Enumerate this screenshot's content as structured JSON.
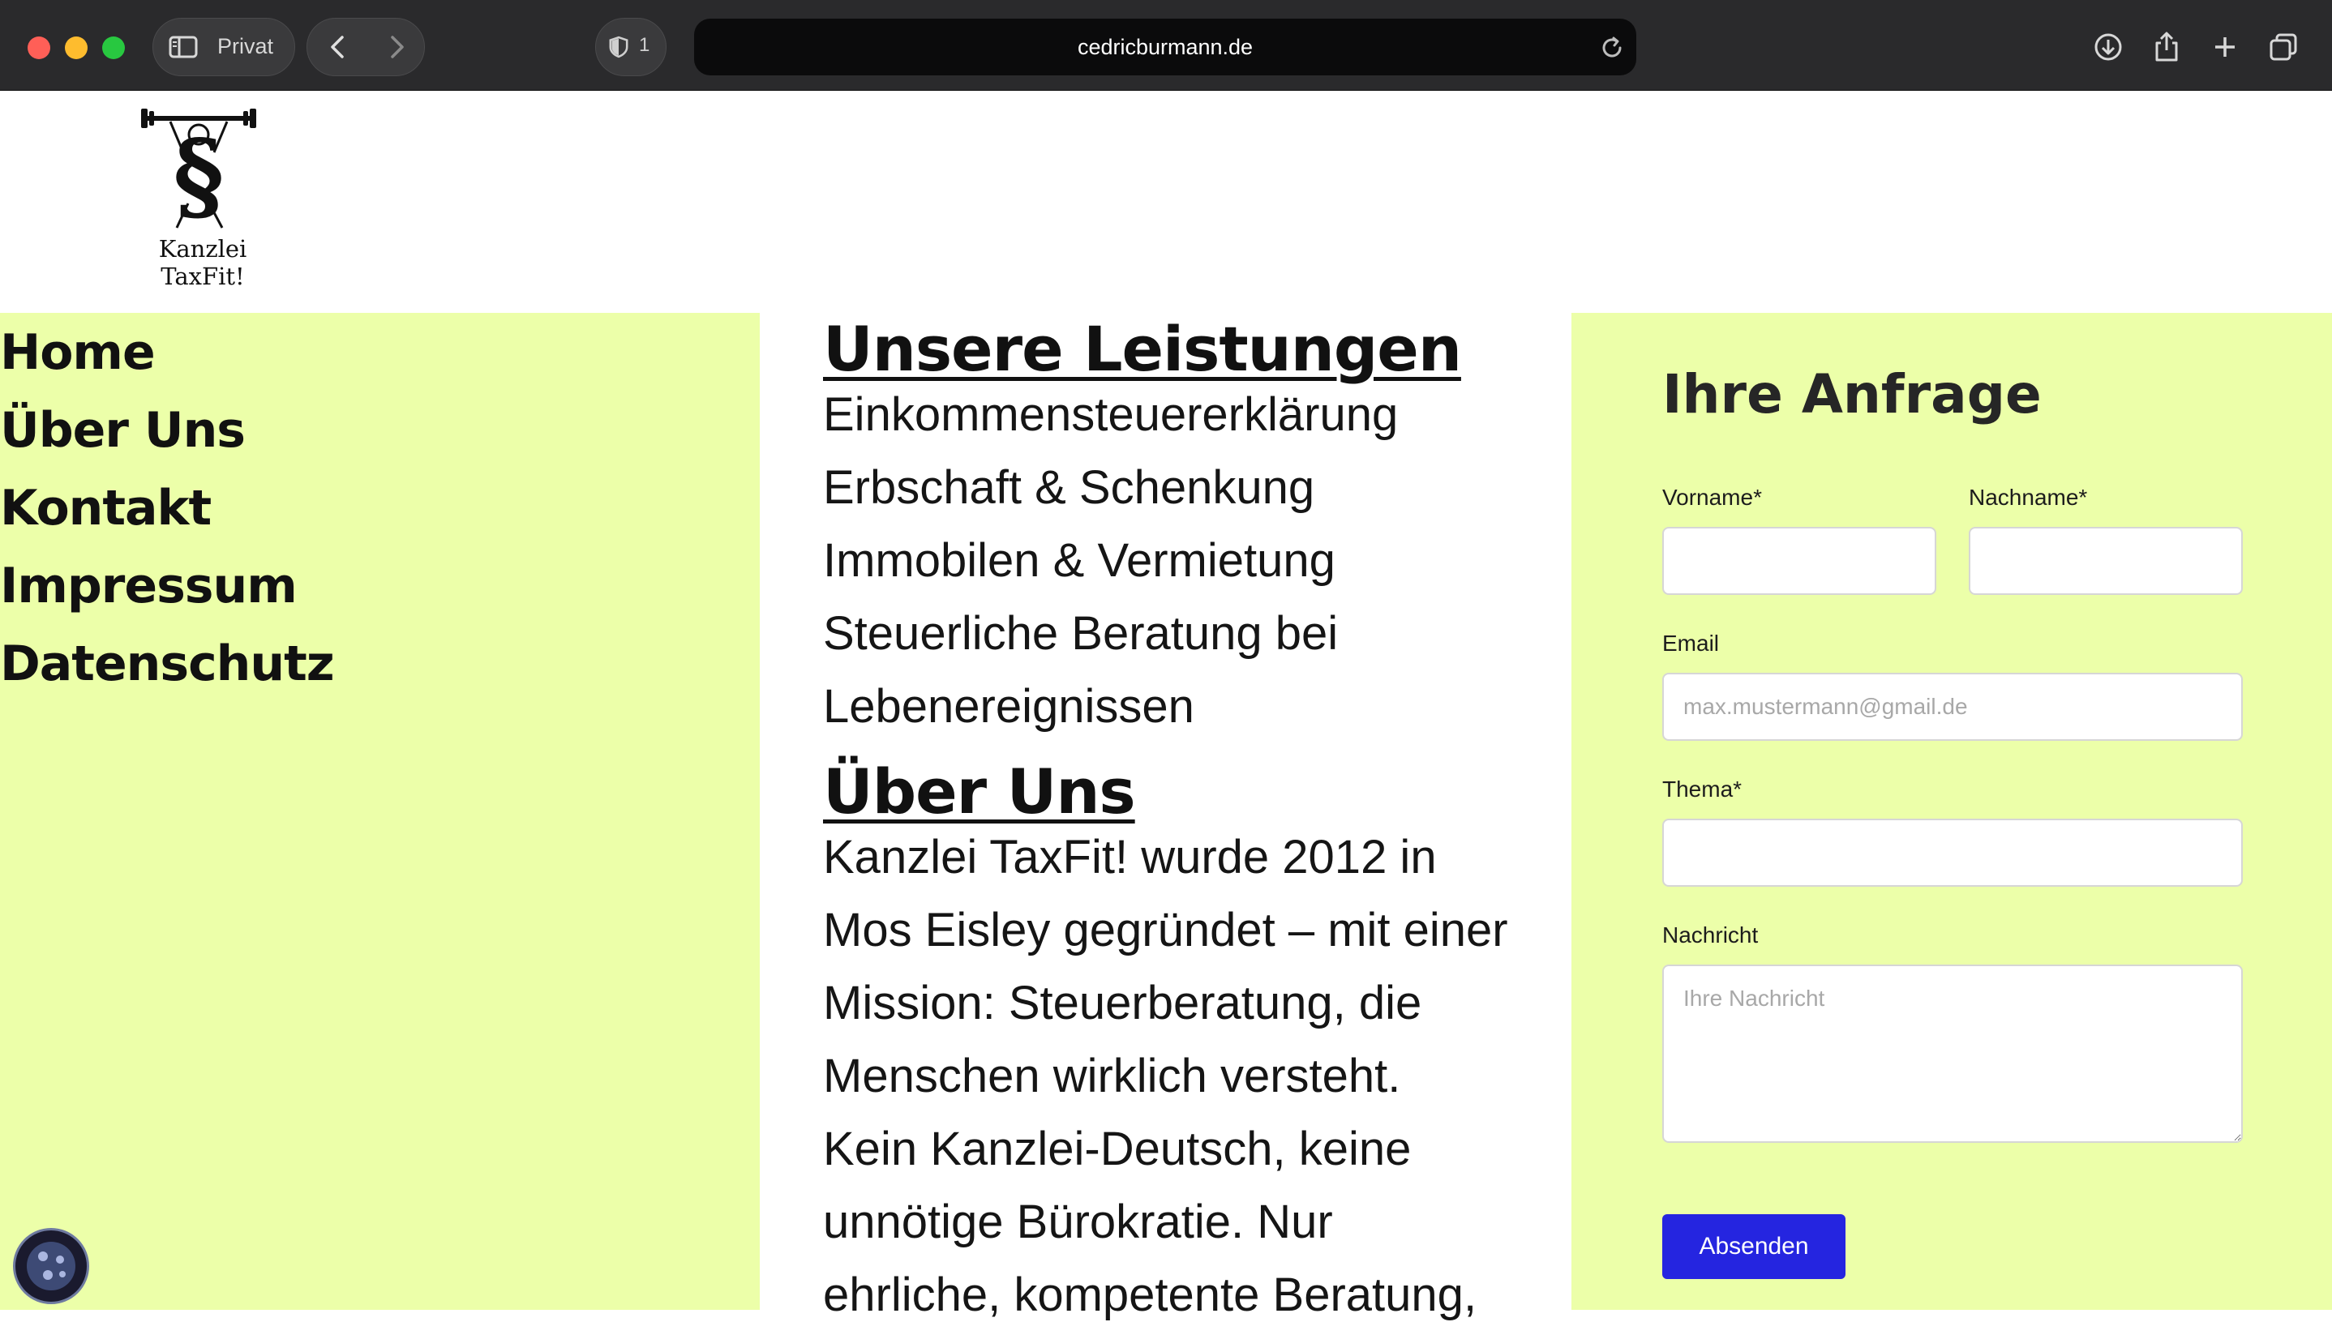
{
  "browser": {
    "private_label": "Privat",
    "tracker_count": "1",
    "url": "cedricburmann.de"
  },
  "logo": {
    "text": "Kanzlei TaxFit!"
  },
  "nav": {
    "items": [
      "Home",
      "Über Uns",
      "Kontakt",
      "Impressum",
      "Datenschutz"
    ]
  },
  "services": {
    "title": "Unsere Leistungen ",
    "lines": [
      "Einkommensteuererklärung",
      "Erbschaft & Schenkung",
      "Immobilen & Vermietung",
      "Steuerliche Beratung bei",
      "Lebenereignissen"
    ]
  },
  "about": {
    "title": "Über Uns",
    "lines": [
      "Kanzlei TaxFit! wurde 2012 in",
      "Mos Eisley gegründet – mit einer",
      "Mission: Steuerberatung, die",
      "Menschen wirklich versteht.",
      "Kein Kanzlei-Deutsch, keine",
      "unnötige Bürokratie. Nur",
      "ehrliche, kompetente Beratung,"
    ]
  },
  "form": {
    "title": "Ihre Anfrage",
    "firstname_label": "Vorname*",
    "lastname_label": "Nachname*",
    "email_label": "Email",
    "email_placeholder": "max.mustermann@gmail.de",
    "topic_label": "Thema*",
    "message_label": "Nachricht",
    "message_placeholder": "Ihre Nachricht",
    "submit_label": "Absenden"
  },
  "colors": {
    "panel_bg": "#ecffa9",
    "button_bg": "#2525e0",
    "chrome_bg": "#2a2a2c"
  },
  "icons": [
    "sidebar-icon",
    "back-icon",
    "forward-icon",
    "shield-icon",
    "reload-icon",
    "download-icon",
    "share-icon",
    "new-tab-icon",
    "tabs-overview-icon",
    "cookie-icon"
  ]
}
